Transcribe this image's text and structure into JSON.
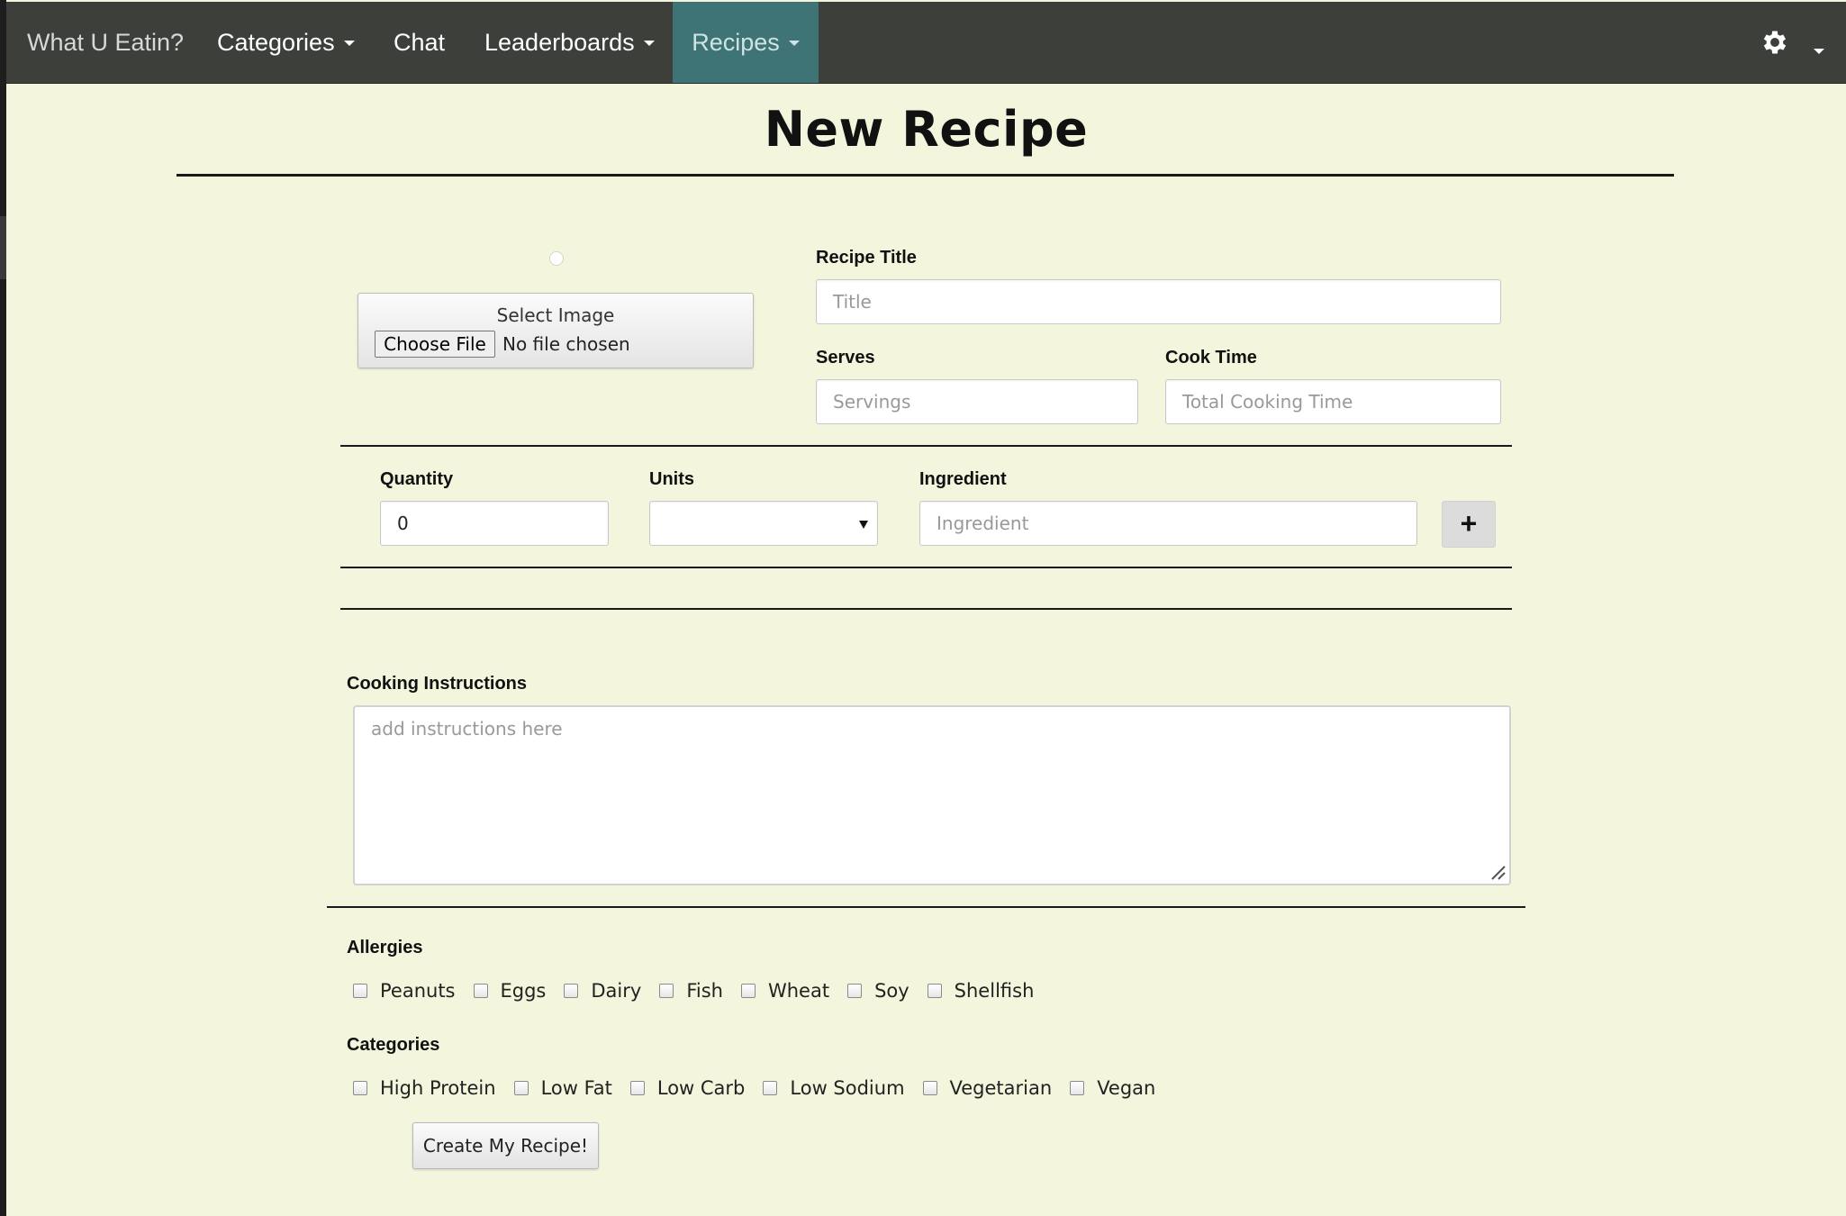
{
  "navbar": {
    "brand": "What U Eatin?",
    "items": [
      {
        "label": "Categories"
      },
      {
        "label": "Chat"
      },
      {
        "label": "Leaderboards"
      },
      {
        "label": "Recipes"
      }
    ],
    "settings_icon": "gear-icon"
  },
  "page": {
    "title": "New Recipe"
  },
  "image_select": {
    "label": "Select Image",
    "button": "Choose File",
    "status": "No file chosen"
  },
  "recipe_title": {
    "label": "Recipe Title",
    "placeholder": "Title"
  },
  "serves": {
    "label": "Serves",
    "placeholder": "Servings"
  },
  "cook_time": {
    "label": "Cook Time",
    "placeholder": "Total Cooking Time"
  },
  "ingredient_row": {
    "quantity_label": "Quantity",
    "quantity_value": "0",
    "units_label": "Units",
    "units_value": "",
    "ingredient_label": "Ingredient",
    "ingredient_placeholder": "Ingredient",
    "add_button": "+"
  },
  "instructions": {
    "label": "Cooking Instructions",
    "placeholder": "add instructions here"
  },
  "allergies": {
    "label": "Allergies",
    "options": [
      "Peanuts",
      "Eggs",
      "Dairy",
      "Fish",
      "Wheat",
      "Soy",
      "Shellfish"
    ]
  },
  "categories": {
    "label": "Categories",
    "options": [
      "High Protein",
      "Low Fat",
      "Low Carb",
      "Low Sodium",
      "Vegetarian",
      "Vegan"
    ]
  },
  "submit_button": "Create My Recipe!",
  "colors": {
    "navbar": "#3d403a",
    "active_tab": "#3f7477",
    "page_background": "#f3f6dc"
  }
}
